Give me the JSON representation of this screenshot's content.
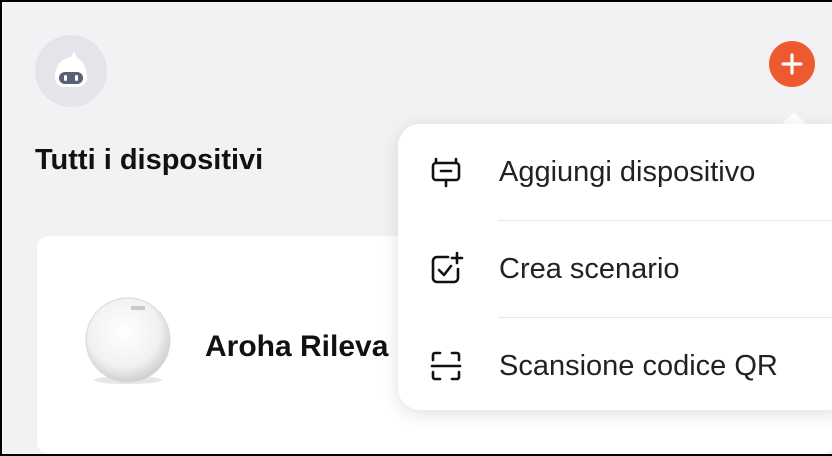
{
  "header": {
    "avatar_icon": "robot-avatar-icon",
    "add_icon": "plus-icon",
    "accent_color": "#ee5a2f"
  },
  "page": {
    "title": "Tutti i dispositivi"
  },
  "devices": [
    {
      "name": "Aroha Rileva",
      "image": "round-smoke-detector"
    }
  ],
  "menu": {
    "items": [
      {
        "label": "Aggiungi dispositivo",
        "icon": "add-device-icon"
      },
      {
        "label": "Crea scenario",
        "icon": "create-scene-icon"
      },
      {
        "label": "Scansione codice QR",
        "icon": "qr-scan-icon"
      }
    ]
  }
}
